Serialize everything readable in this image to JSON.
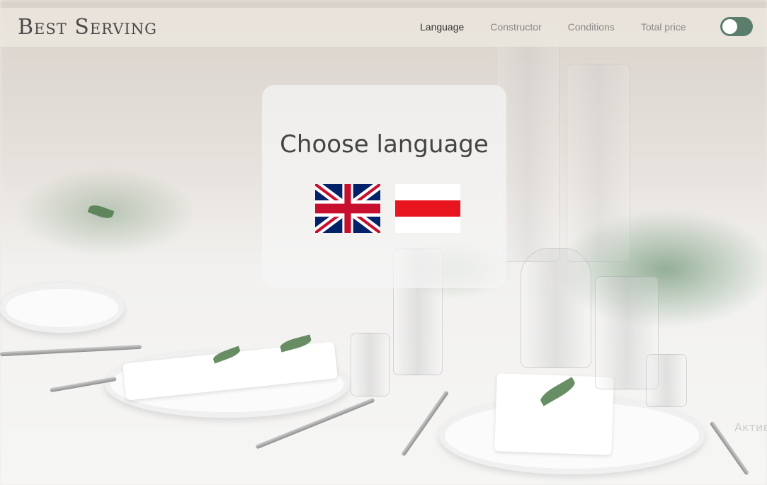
{
  "header": {
    "logo": "Best Serving",
    "nav": [
      {
        "label": "Language",
        "active": true
      },
      {
        "label": "Constructor",
        "active": false
      },
      {
        "label": "Conditions",
        "active": false
      },
      {
        "label": "Total price",
        "active": false
      }
    ],
    "theme_toggle": {
      "on": true,
      "color": "#5b7d6c"
    }
  },
  "modal": {
    "title": "Choose language",
    "options": [
      {
        "icon": "uk-flag-icon"
      },
      {
        "icon": "belarus-flag-icon"
      }
    ]
  },
  "watermark": "Актив"
}
